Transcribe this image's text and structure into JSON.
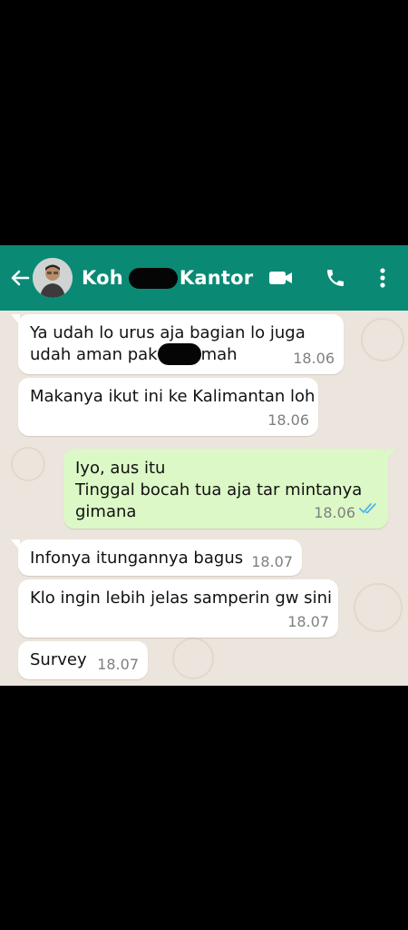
{
  "header": {
    "contact_name_part1": "Koh",
    "contact_name_part2": "Kantor",
    "accent_color": "#0a8a74",
    "icons": [
      "back-arrow-icon",
      "avatar",
      "video-call-icon",
      "phone-icon",
      "more-options-icon"
    ]
  },
  "messages": [
    {
      "direction": "incoming",
      "line1": "Ya udah lo urus aja bagian lo juga",
      "line2_before": "udah aman pak",
      "line2_after": "mah",
      "time": "18.06"
    },
    {
      "direction": "incoming",
      "text": "Makanya ikut ini ke Kalimantan loh",
      "time": "18.06"
    },
    {
      "direction": "outgoing",
      "line1": "Iyo, aus itu",
      "line2": "Tinggal bocah tua aja tar mintanya",
      "line3": "gimana",
      "time": "18.06",
      "status": "read"
    },
    {
      "direction": "incoming",
      "text": "Infonya itungannya bagus",
      "time": "18.07"
    },
    {
      "direction": "incoming",
      "text": "Klo ingin lebih jelas samperin gw sini",
      "time": "18.07"
    },
    {
      "direction": "incoming",
      "text": "Survey",
      "time": "18.07"
    }
  ]
}
